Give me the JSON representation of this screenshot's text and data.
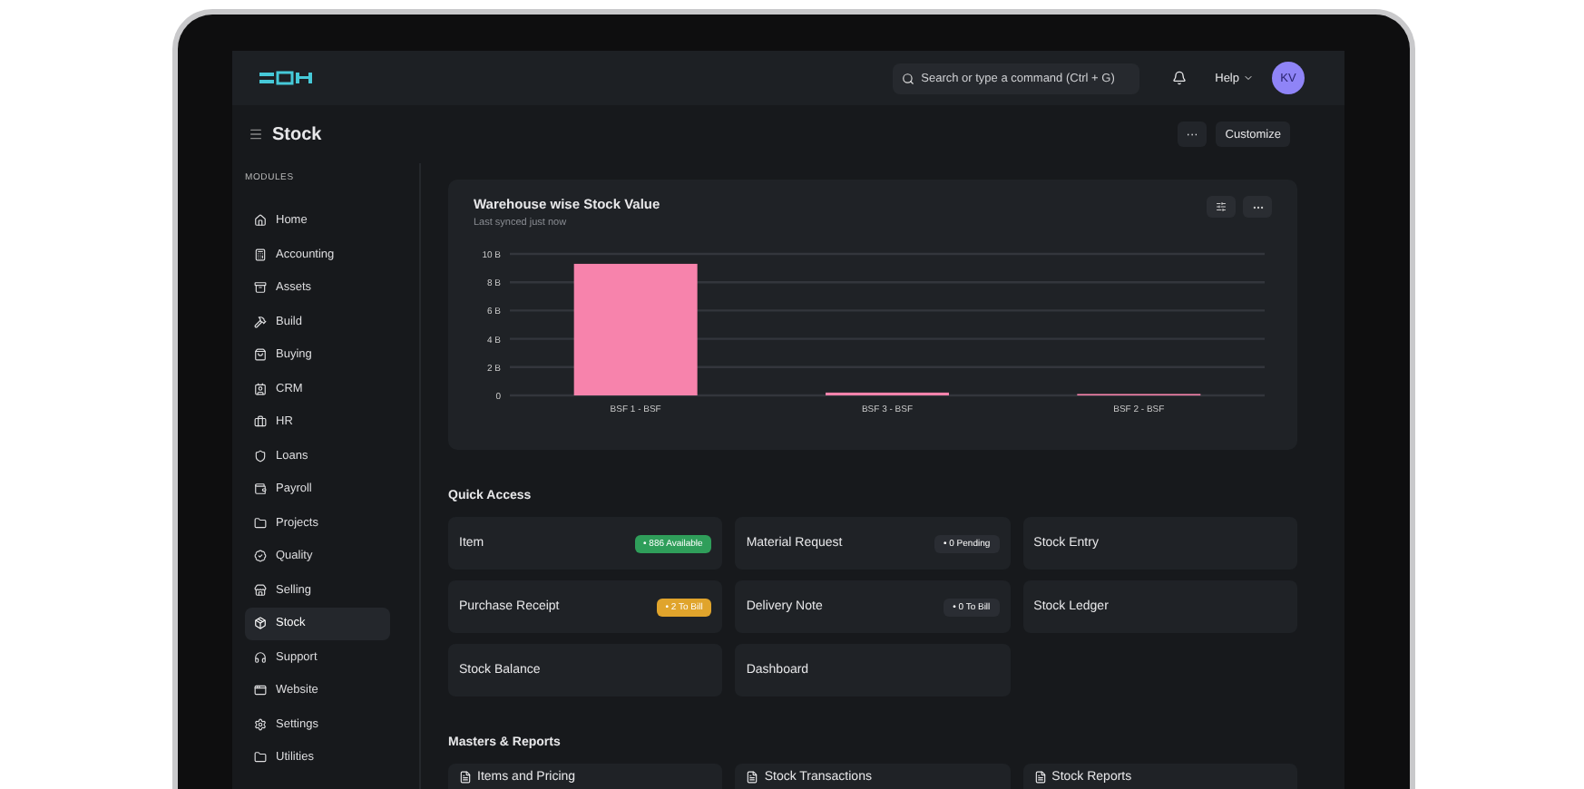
{
  "topbar": {
    "search": {
      "placeholder": "Search or type a command (Ctrl + G)"
    },
    "help": "Help",
    "avatar": "KV"
  },
  "page": {
    "title": "Stock",
    "more": "···",
    "customize": "Customize"
  },
  "sidebar": {
    "heading": "MODULES",
    "items": [
      {
        "label": "Home",
        "selected": false
      },
      {
        "label": "Accounting",
        "selected": false
      },
      {
        "label": "Assets",
        "selected": false
      },
      {
        "label": "Build",
        "selected": false
      },
      {
        "label": "Buying",
        "selected": false
      },
      {
        "label": "CRM",
        "selected": false
      },
      {
        "label": "HR",
        "selected": false
      },
      {
        "label": "Loans",
        "selected": false
      },
      {
        "label": "Payroll",
        "selected": false
      },
      {
        "label": "Projects",
        "selected": false
      },
      {
        "label": "Quality",
        "selected": false
      },
      {
        "label": "Selling",
        "selected": false
      },
      {
        "label": "Stock",
        "selected": true
      },
      {
        "label": "Support",
        "selected": false
      },
      {
        "label": "Website",
        "selected": false
      },
      {
        "label": "Settings",
        "selected": false
      },
      {
        "label": "Utilities",
        "selected": false
      }
    ]
  },
  "chart_card": {
    "title": "Warehouse wise Stock Value",
    "subtitle": "Last synced just now",
    "chart_data": {
      "type": "bar",
      "categories": [
        "BSF 1 - BSF",
        "BSF 3 - BSF",
        "BSF 2 - BSF"
      ],
      "series": [
        {
          "color": "#f783ac",
          "values": [
            9.3,
            0.2,
            0.1
          ]
        }
      ],
      "ylim": [
        0,
        10
      ],
      "grid": true,
      "yticks": [
        {
          "value": 0,
          "label": "0"
        },
        {
          "value": 2,
          "label": "2 B"
        },
        {
          "value": 4,
          "label": "4 B"
        },
        {
          "value": 6,
          "label": "6 B"
        },
        {
          "value": 8,
          "label": "8 B"
        },
        {
          "value": 10,
          "label": "10 B"
        }
      ]
    }
  },
  "quick_access": {
    "heading": "Quick Access",
    "items": [
      {
        "label": "Item",
        "badge": "• 886 Available",
        "color": "#2f9e5a"
      },
      {
        "label": "Material Request",
        "badge": "• 0 Pending",
        "color": "#2a2d33"
      },
      {
        "label": "Stock Entry"
      },
      {
        "label": "Purchase Receipt",
        "badge": "• 2 To Bill",
        "color": "#e0a42c"
      },
      {
        "label": "Delivery Note",
        "badge": "• 0 To Bill",
        "color": "#2a2d33"
      },
      {
        "label": "Stock Ledger"
      },
      {
        "label": "Stock Balance"
      },
      {
        "label": "Dashboard"
      }
    ]
  },
  "masters_reports": {
    "heading": "Masters & Reports",
    "cards": [
      "Items and Pricing",
      "Stock Transactions",
      "Stock Reports"
    ]
  }
}
